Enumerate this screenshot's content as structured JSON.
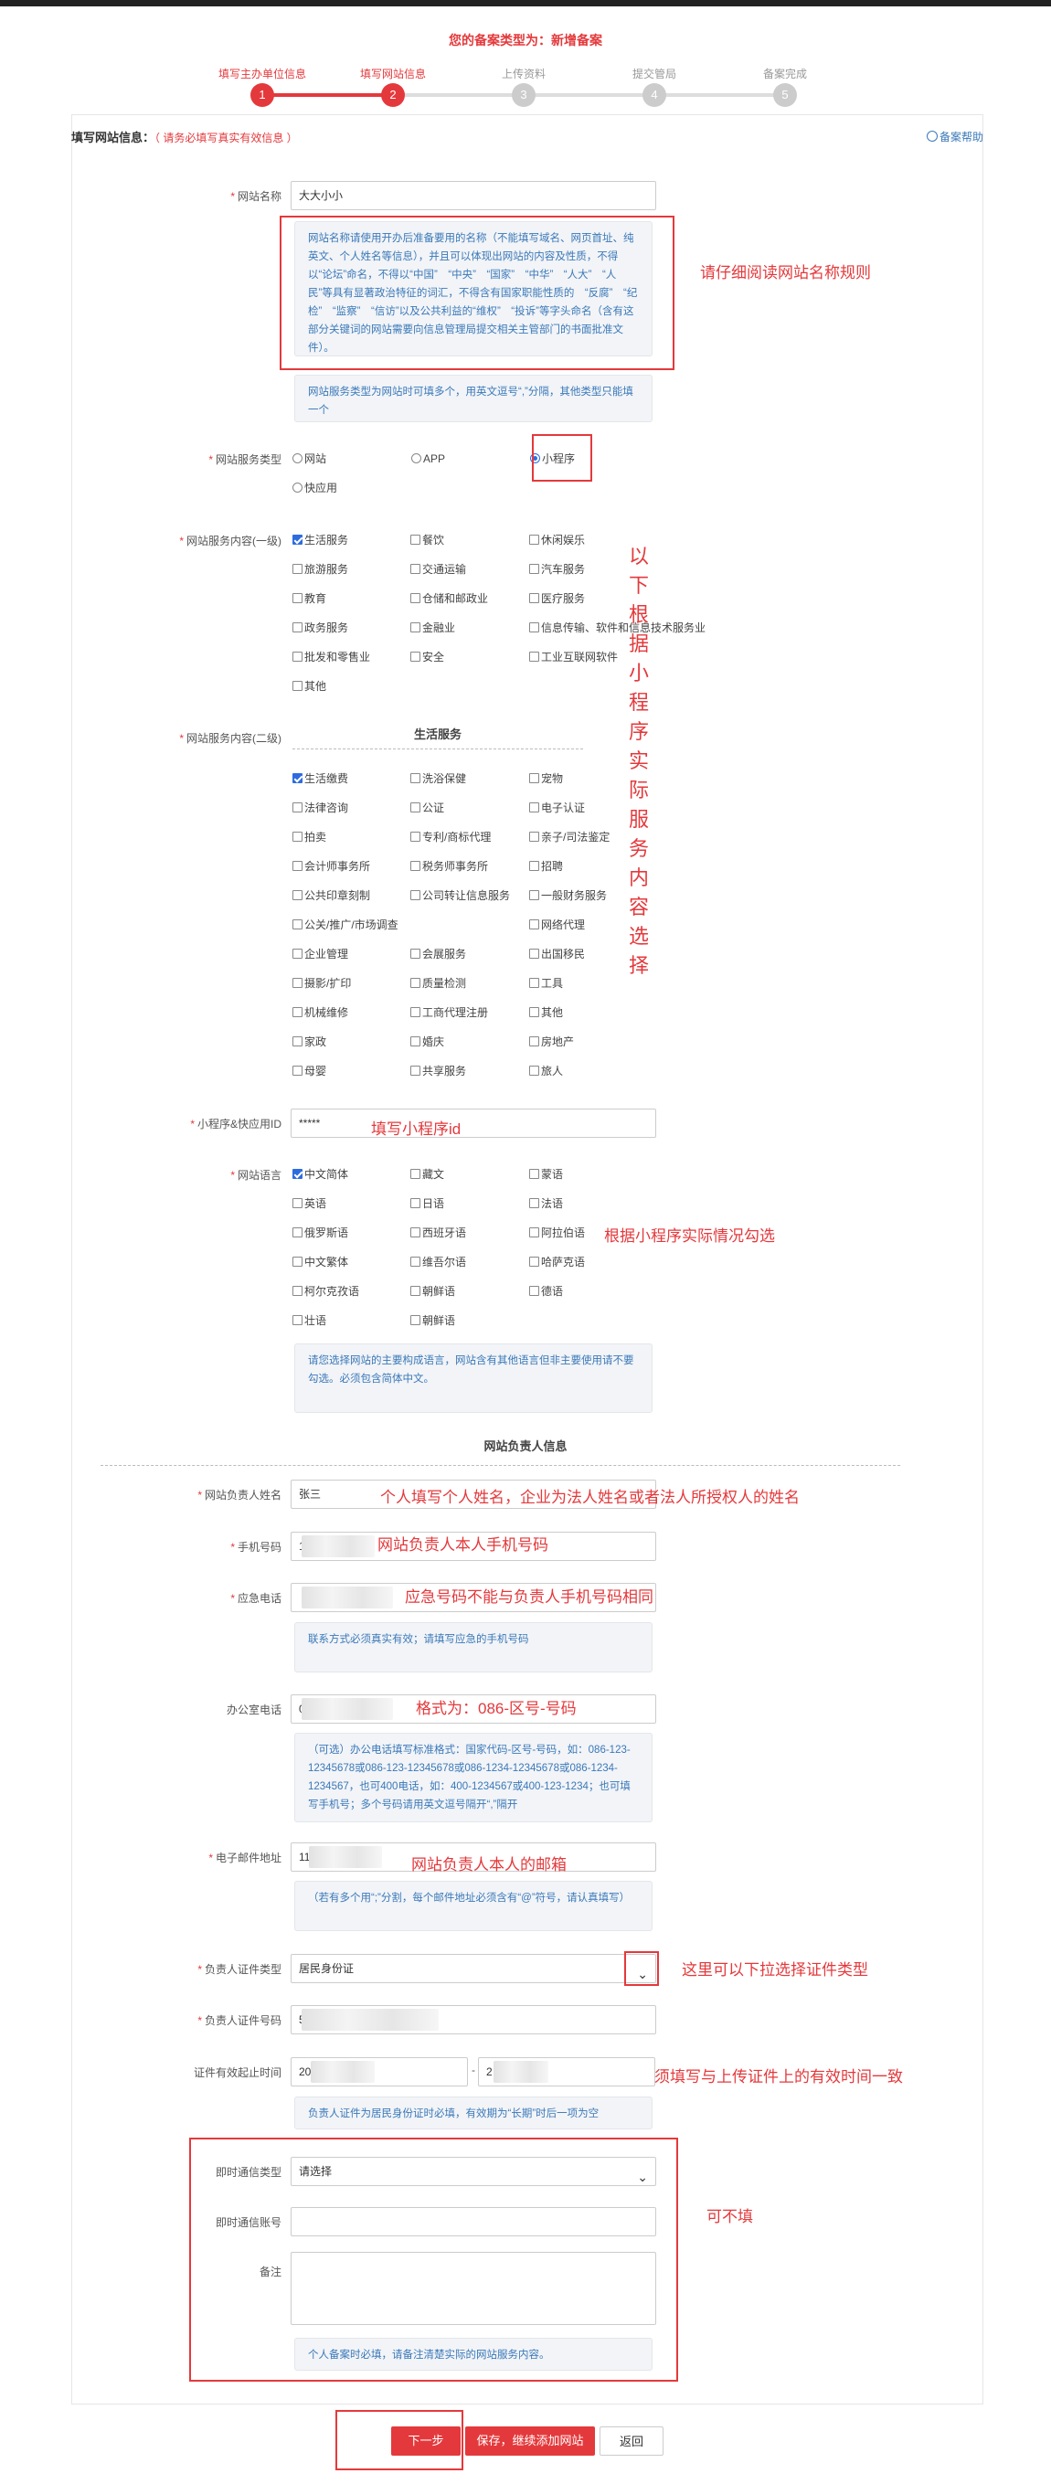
{
  "header": {
    "title_prefix": "您的备案类型为：",
    "title_value": "新增备案"
  },
  "steps": [
    {
      "num": "1",
      "label": "填写主办单位信息",
      "active": true
    },
    {
      "num": "2",
      "label": "填写网站信息",
      "active": true
    },
    {
      "num": "3",
      "label": "上传资料",
      "active": false
    },
    {
      "num": "4",
      "label": "提交管局",
      "active": false
    },
    {
      "num": "5",
      "label": "备案完成",
      "active": false
    }
  ],
  "section": {
    "title": "填写网站信息：",
    "hint": "（ 请务必填写真实有效信息 ）",
    "help": "备案帮助"
  },
  "site_name": {
    "label": "网站名称",
    "value": "大大小小",
    "note": "网站名称请使用开办后准备要用的名称（不能填写域名、网页首址、纯英文、个人姓名等信息），并且可以体现出网站的内容及性质，不得以“论坛”命名，不得以“中国”　“中央”　“国家”　“中华”　“人大”　“人民”等具有显著政治特征的词汇，不得含有国家职能性质的　“反腐”　“纪检”　“监察”　“信访”以及公共利益的“维权”　“投诉”等字头命名（含有这部分关键词的网站需要向信息管理局提交相关主管部门的书面批准文件）。",
    "annotation": "请仔细阅读网站名称规则"
  },
  "service_type": {
    "note": "网站服务类型为网站时可填多个，用英文逗号“,”分隔，其他类型只能填一个",
    "label": "网站服务类型",
    "options": [
      "网站",
      "APP",
      "小程序",
      "快应用"
    ],
    "selected": "小程序"
  },
  "content_l1": {
    "label": "网站服务内容(一级)",
    "items": [
      "生活服务",
      "餐饮",
      "休闲娱乐",
      "旅游服务",
      "交通运输",
      "汽车服务",
      "教育",
      "仓储和邮政业",
      "医疗服务",
      "政务服务",
      "金融业",
      "信息传输、软件和信息技术服务业",
      "批发和零售业",
      "安全",
      "工业互联网软件",
      "其他"
    ],
    "checked": [
      "生活服务"
    ],
    "annotation": "以下根据小程序实际服务内容选择"
  },
  "content_l2": {
    "label": "网站服务内容(二级)",
    "group_title": "生活服务",
    "items": [
      "生活缴费",
      "洗浴保健",
      "宠物",
      "法律咨询",
      "公证",
      "电子认证",
      "拍卖",
      "专利/商标代理",
      "亲子/司法鉴定",
      "会计师事务所",
      "税务师事务所",
      "招聘",
      "公共印章刻制",
      "公司转让信息服务",
      "一般财务服务",
      "公关/推广/市场调查",
      "",
      "网络代理",
      "企业管理",
      "会展服务",
      "出国移民",
      "摄影/扩印",
      "质量检测",
      "工具",
      "机械维修",
      "工商代理注册",
      "其他",
      "家政",
      "婚庆",
      "房地产",
      "母婴",
      "共享服务",
      "旅人"
    ],
    "checked": [
      "生活缴费"
    ]
  },
  "app_id": {
    "label": "小程序&快应用ID",
    "value": "*****",
    "annotation": "填写小程序id"
  },
  "language": {
    "label": "网站语言",
    "items": [
      "中文简体",
      "藏文",
      "蒙语",
      "英语",
      "日语",
      "法语",
      "俄罗斯语",
      "西班牙语",
      "阿拉伯语",
      "中文繁体",
      "维吾尔语",
      "哈萨克语",
      "柯尔克孜语",
      "朝鲜语",
      "德语",
      "壮语",
      "朝鲜语"
    ],
    "checked": [
      "中文简体"
    ],
    "annotation": "根据小程序实际情况勾选",
    "note": "请您选择网站的主要构成语言，网站含有其他语言但非主要使用请不要勾选。必须包含简体中文。"
  },
  "owner_section": {
    "title": "网站负责人信息"
  },
  "owner": {
    "name_label": "网站负责人姓名",
    "name_value": "张三",
    "name_annotation": "个人填写个人姓名，企业为法人姓名或者法人所授权人的姓名",
    "phone_label": "手机号码",
    "phone_value": "1",
    "phone_annotation": "网站负责人本人手机号码",
    "emergency_label": "应急电话",
    "emergency_annotation": "应急号码不能与负责人手机号码相同",
    "emergency_note": "联系方式必须真实有效；请填写应急的手机号码",
    "office_label": "办公室电话",
    "office_value": "0",
    "office_annotation": "格式为：086-区号-号码",
    "office_note": "（可选）办公电话填写标准格式：国家代码-区号-号码，如：086-123-12345678或086-123-12345678或086-1234-12345678或086-1234-1234567，也可400电话，如：400-1234567或400-123-1234；也可填写手机号；多个号码请用英文逗号隔开“,”隔开",
    "email_label": "电子邮件地址",
    "email_value": "11",
    "email_annotation": "网站负责人本人的邮箱",
    "email_note": "（若有多个用“;”分割，每个邮件地址必须含有“@”符号，请认真填写）",
    "cert_type_label": "负责人证件类型",
    "cert_type_value": "居民身份证",
    "cert_type_annotation": "这里可以下拉选择证件类型",
    "cert_no_label": "负责人证件号码",
    "cert_no_value": "5",
    "validity_label": "证件有效起止时间",
    "validity_start": "20",
    "validity_end": "2",
    "validity_sep": "-",
    "validity_annotation": "须填写与上传证件上的有效时间一致",
    "validity_note": "负责人证件为居民身份证时必填，有效期为“长期”时后一项为空"
  },
  "optional": {
    "im_type_label": "即时通信类型",
    "im_type_value": "请选择",
    "im_account_label": "即时通信账号",
    "remark_label": "备注",
    "remark_note": "个人备案时必填，请备注清楚实际的网站服务内容。",
    "annotation": "可不填"
  },
  "actions": {
    "next": "下一步",
    "save_add": "保存，继续添加网站",
    "back": "返回"
  },
  "colors": {
    "accent": "#e4393c",
    "note_text": "#3a78b9",
    "check": "#2d6cdf"
  }
}
